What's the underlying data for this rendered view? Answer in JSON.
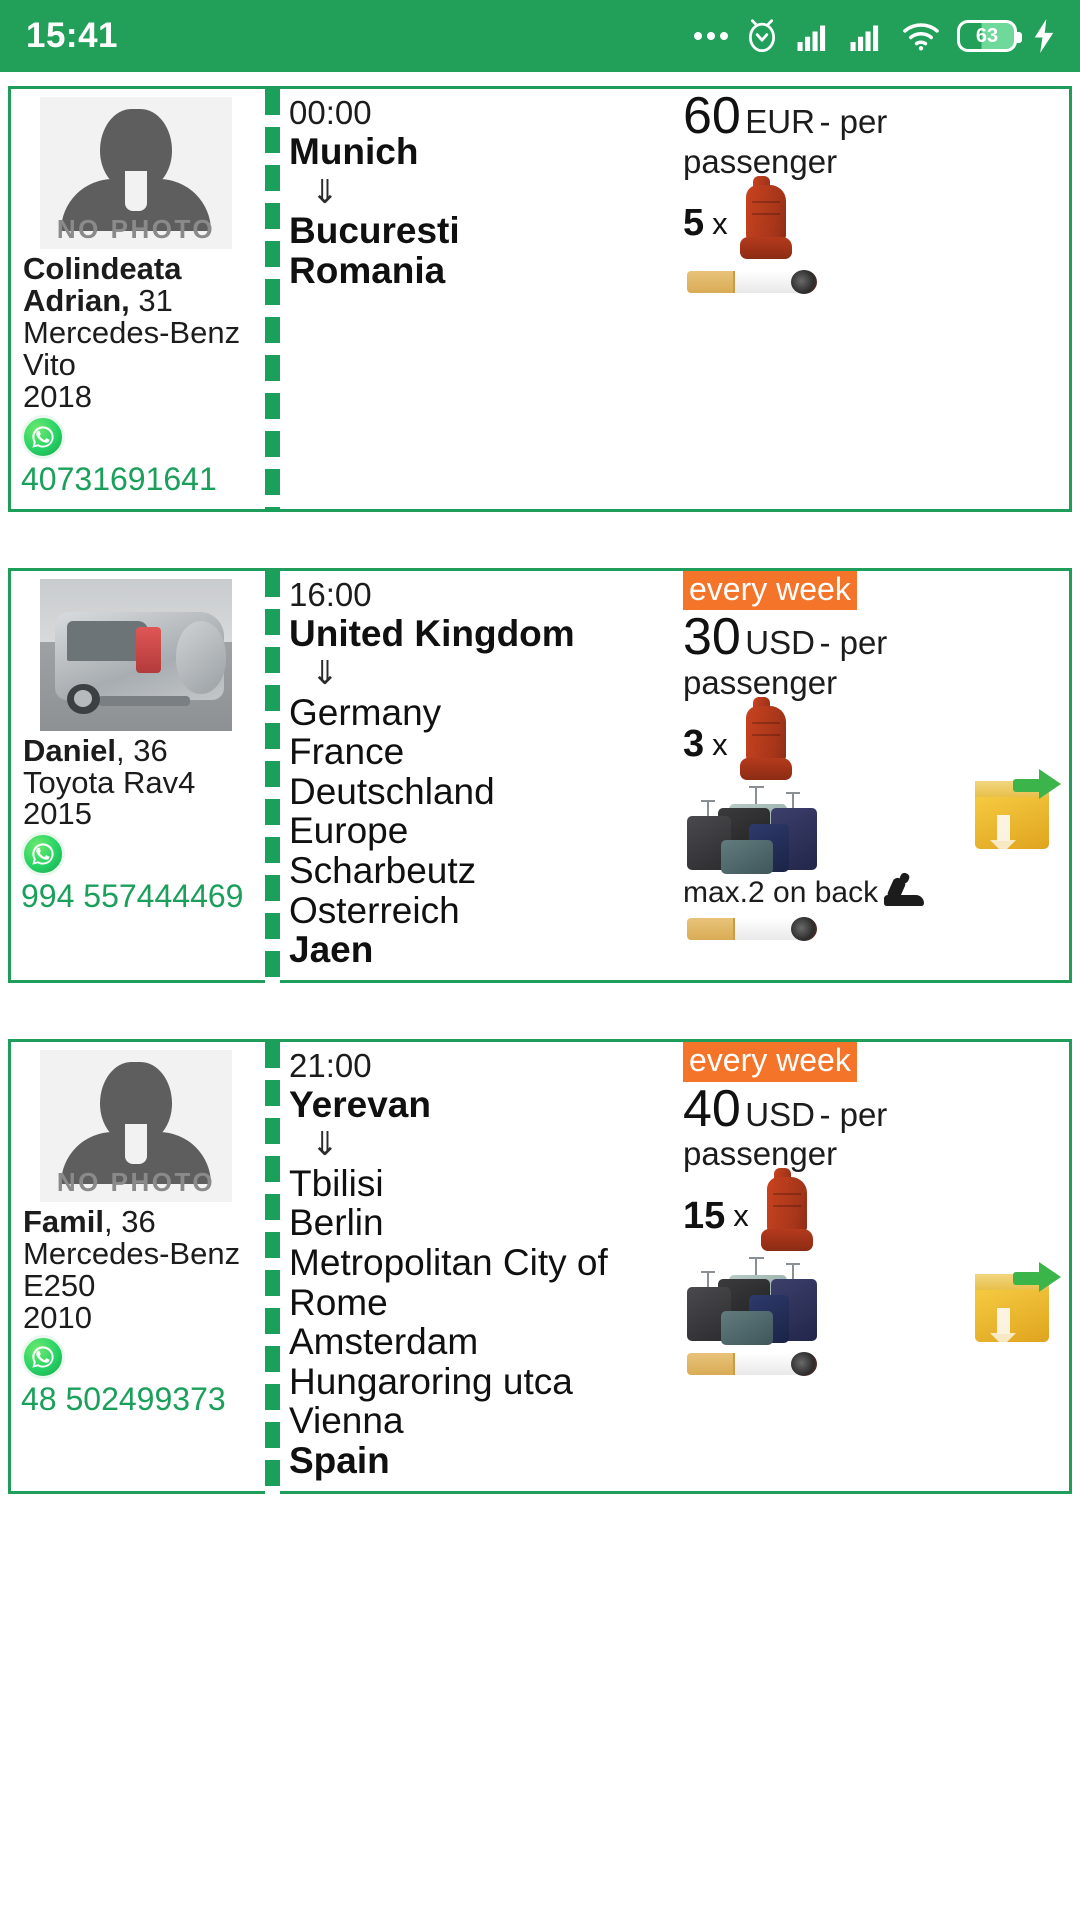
{
  "status_bar": {
    "time": "15:41",
    "battery_percent": "63",
    "icons": [
      "more-dots-icon",
      "alarm-clock-icon",
      "signal-bars-icon",
      "signal-bars-icon",
      "wifi-icon",
      "battery-icon",
      "charging-bolt-icon"
    ]
  },
  "colors": {
    "brand_green": "#22a05a",
    "card_border": "#1e9e5a",
    "route_dash": "#1ba05b",
    "phone_green": "#1ba05b",
    "badge_orange": "#f4742a",
    "text_dark": "#1c1c1c"
  },
  "labels": {
    "no_photo": "NO PHOTO",
    "per_passenger": "- per passenger",
    "seat_multiplier": "x",
    "arrow": "⇓"
  },
  "rides": [
    {
      "driver": {
        "name": "Colindeata Adrian,",
        "age": "31",
        "car_make": "Mercedes-Benz",
        "car_model": "Vito",
        "car_year": "2018",
        "phone": "40731691641",
        "has_photo": false
      },
      "route": {
        "time": "00:00",
        "origin": "Munich",
        "stops": [],
        "destination_lines": [
          "Bucuresti",
          "Romania"
        ]
      },
      "price": {
        "amount": "60",
        "currency": "EUR",
        "unit": "- per",
        "unit_second_line": "passenger",
        "recurring_badge": null
      },
      "amenities": {
        "seats": "5",
        "has_luggage": false,
        "max_on_back": null,
        "smoking": true,
        "parcel_delivery": false
      }
    },
    {
      "driver": {
        "name": "Daniel",
        "age": "36",
        "car_make": "Toyota Rav4",
        "car_model": "",
        "car_year": "2015",
        "phone": "994 557444469",
        "has_photo": true
      },
      "route": {
        "time": "16:00",
        "origin": "United Kingdom",
        "stops": [
          "Germany",
          "France",
          "Deutschland",
          "Europe",
          "Scharbeutz",
          "Osterreich"
        ],
        "destination_lines": [
          "Jaen"
        ]
      },
      "price": {
        "amount": "30",
        "currency": "USD",
        "unit": "- per",
        "unit_second_line": "passenger",
        "recurring_badge": "every week"
      },
      "amenities": {
        "seats": "3",
        "has_luggage": true,
        "max_on_back": "max.2 on back",
        "smoking": true,
        "parcel_delivery": true
      }
    },
    {
      "driver": {
        "name": "Famil",
        "age": "36",
        "car_make": "Mercedes-Benz",
        "car_model": "E250",
        "car_year": "2010",
        "phone": "48 502499373",
        "has_photo": false
      },
      "route": {
        "time": "21:00",
        "origin": "Yerevan",
        "stops": [
          "Tbilisi",
          "Berlin",
          "Metropolitan City of Rome",
          "Amsterdam",
          "Hungaroring utca",
          "Vienna"
        ],
        "destination_lines": [
          "Spain"
        ]
      },
      "price": {
        "amount": "40",
        "currency": "USD",
        "unit": "- per",
        "unit_second_line": "passenger",
        "recurring_badge": "every week"
      },
      "amenities": {
        "seats": "15",
        "has_luggage": true,
        "max_on_back": null,
        "smoking": true,
        "parcel_delivery": true
      }
    }
  ]
}
